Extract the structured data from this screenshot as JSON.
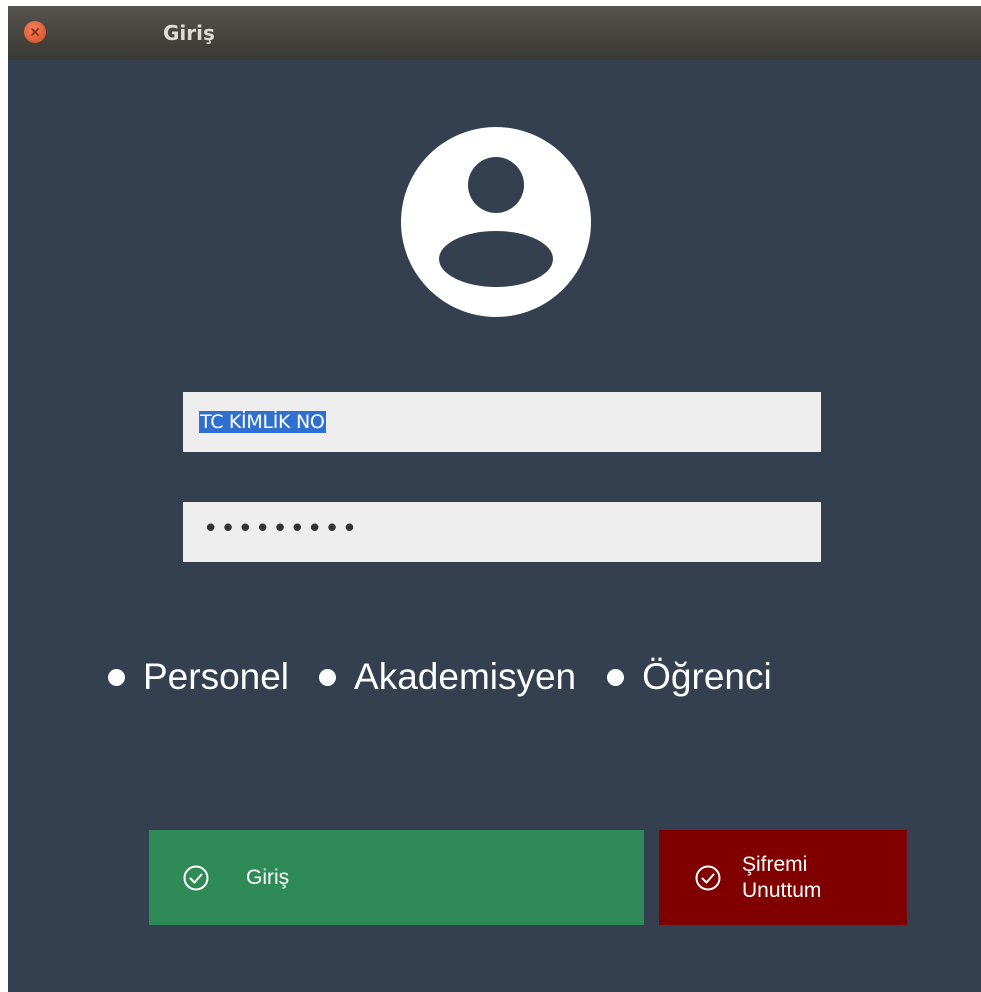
{
  "window": {
    "title": "Giriş"
  },
  "login_form": {
    "username_value": "TC KİMLİK NO",
    "password_mask": "•••••••••",
    "roles": [
      {
        "label": "Personel"
      },
      {
        "label": "Akademisyen"
      },
      {
        "label": "Öğrenci"
      }
    ],
    "login_button_label": "Giriş",
    "forgot_button_label": "Şifremi Unuttum"
  },
  "icons": {
    "avatar": "user-circle-icon",
    "close": "close-icon",
    "check": "check-circle-icon"
  },
  "colors": {
    "background": "#34404f",
    "login_button": "#2e8b57",
    "forgot_button": "#800000",
    "selection": "#2f6fd0",
    "close_button": "#e05a32"
  }
}
